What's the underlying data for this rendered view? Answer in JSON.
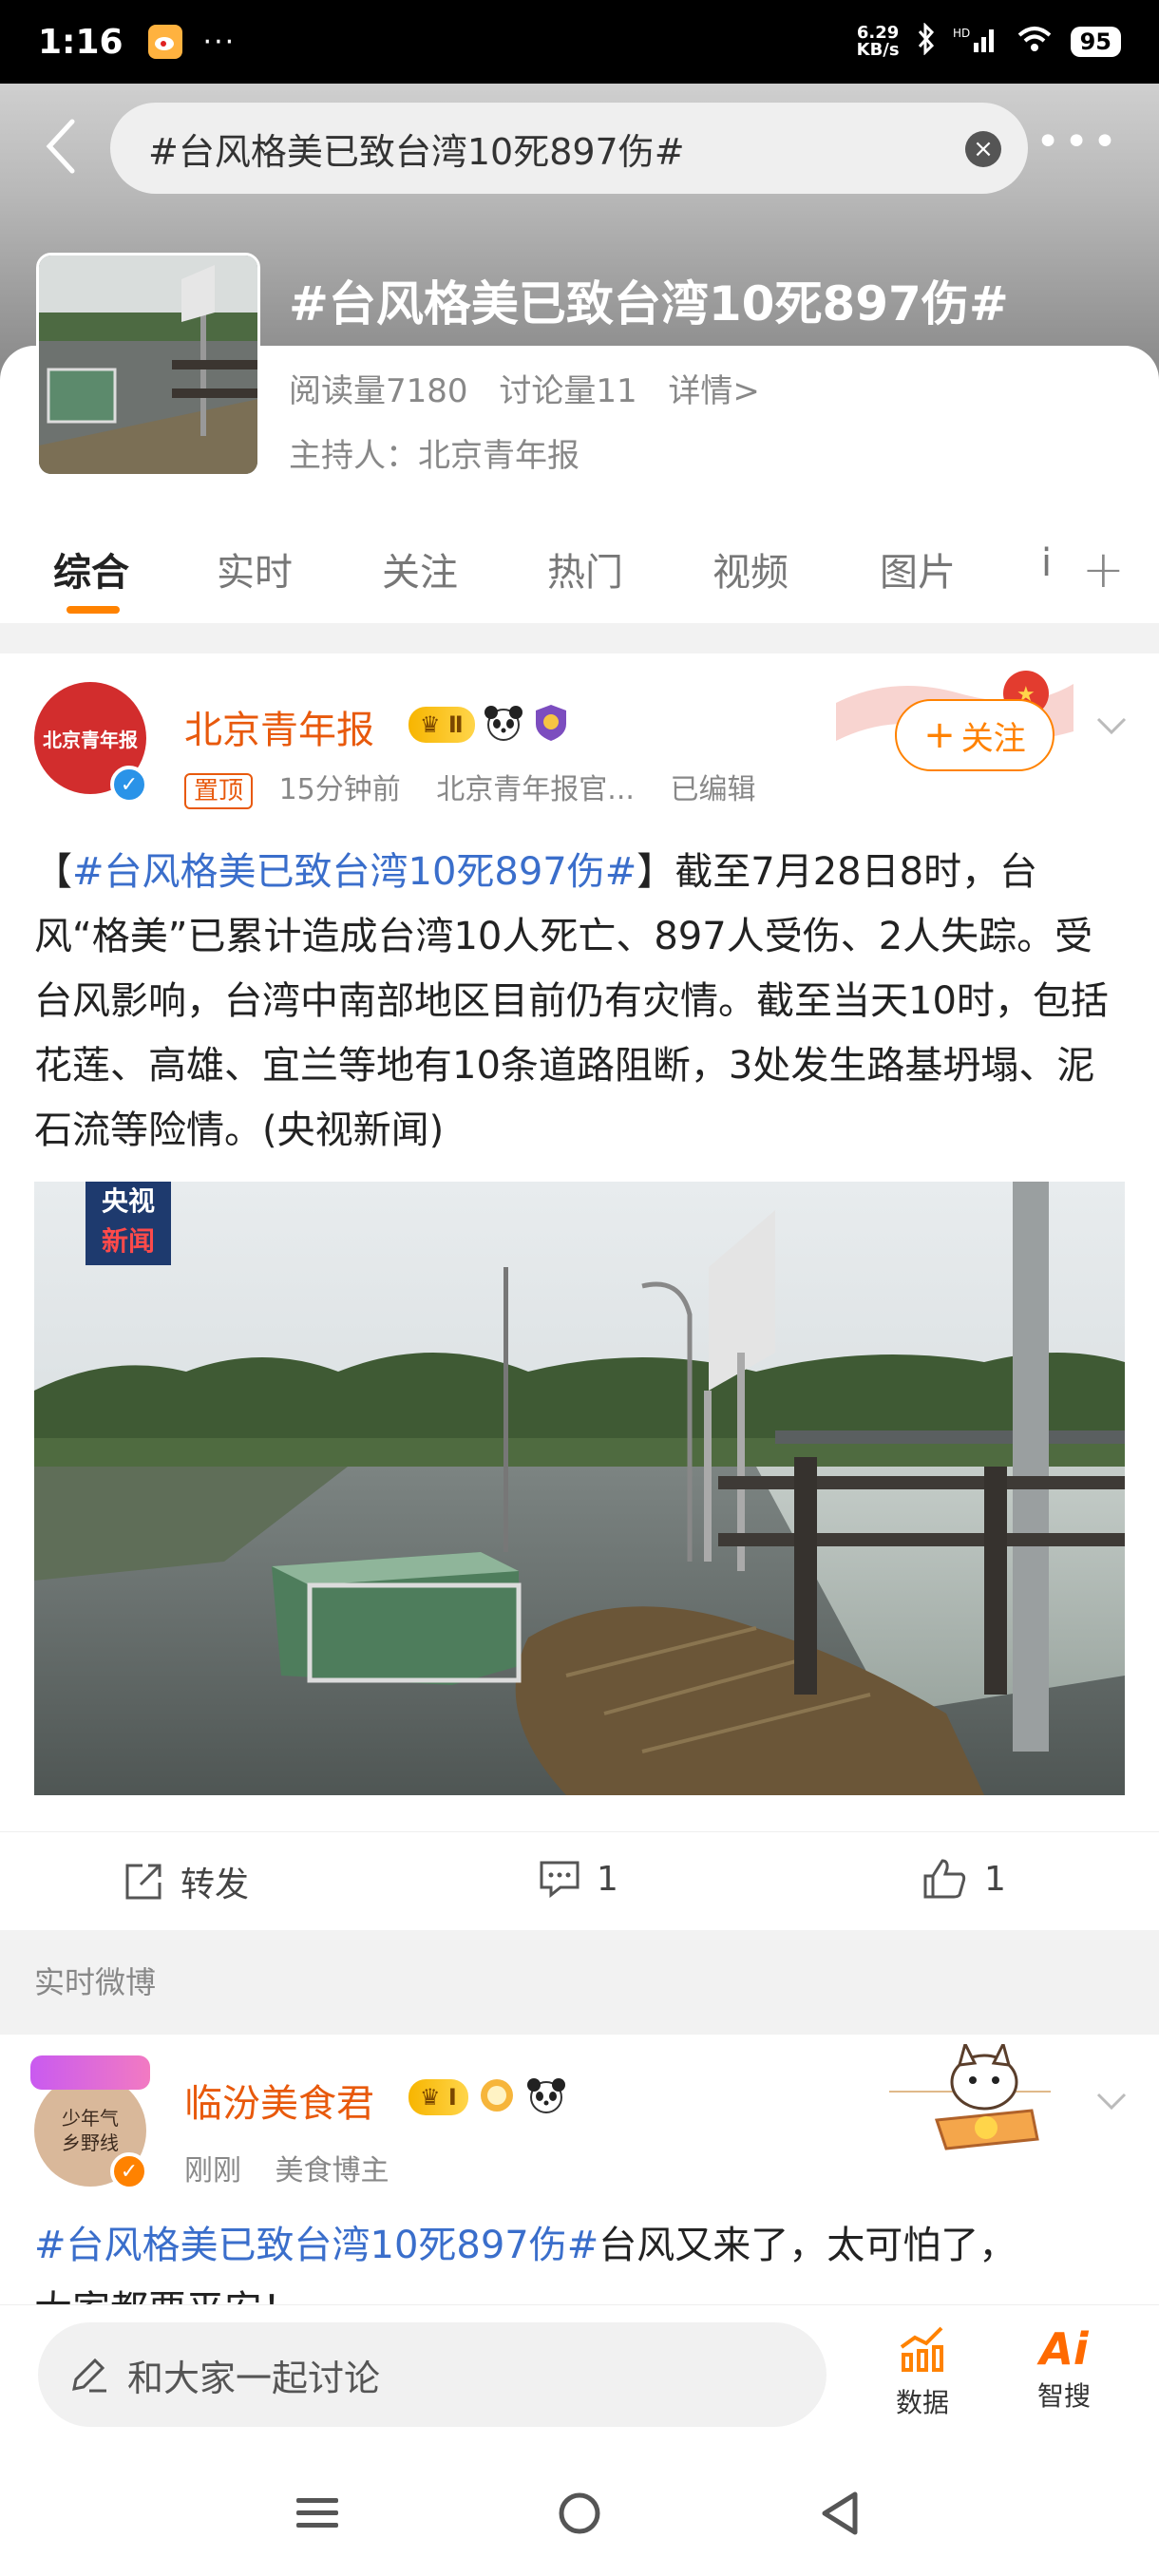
{
  "status_bar": {
    "time": "1:16",
    "dots": "···",
    "net_speed_value": "6.29",
    "net_speed_unit": "KB/s",
    "battery": "95"
  },
  "search": {
    "query": "#台风格美已致台湾10死897伤#",
    "clear_glyph": "×",
    "more_glyph": "•••"
  },
  "topic": {
    "title": "#台风格美已致台湾10死897伤#",
    "reads": "阅读量7180",
    "discussions": "讨论量11",
    "details": "详情>",
    "host": "主持人：北京青年报"
  },
  "tabs": [
    "综合",
    "实时",
    "关注",
    "热门",
    "视频",
    "图片",
    "i"
  ],
  "tab_plus": "+",
  "post1": {
    "user": "北京青年报",
    "vip_level": "Ⅱ",
    "pinned": "置顶",
    "time": "15分钟前",
    "source": "北京青年报官...",
    "edited": "已编辑",
    "follow": "关注",
    "follow_plus": "+",
    "text_open": "【",
    "text_tag": "#台风格美已致台湾10死897伤#",
    "text_body": "】截至7月28日8时，台风“格美”已累计造成台湾10人死亡、897人受伤、2人失踪。受台风影响，台湾中南部地区目前仍有灾情。截至当天10时，包括花莲、高雄、宜兰等地有10条道路阻断，3处发生路基坍塌、泥石流等险情。(央视新闻)",
    "watermark_line1": "央视",
    "watermark_line2": "新闻",
    "avatar_text": "北京青年报",
    "repost_label": "转发",
    "comments": "1",
    "likes": "1"
  },
  "section_label": "实时微博",
  "post2": {
    "user": "临汾美食君",
    "vip_level": "Ⅰ",
    "time": "刚刚",
    "role": "美食博主",
    "avatar_text": "少年气 乡野线",
    "text_tag": "#台风格美已致台湾10死897伤#",
    "text_body": "台风又来了，太可怕了，",
    "text_line2": "大家都要平安！"
  },
  "bottom": {
    "discuss_placeholder": "和大家一起讨论",
    "data_label": "数据",
    "ai_label": "智搜",
    "ai_glyph": "Ai"
  },
  "colors": {
    "accent": "#ff8200",
    "username": "#e8590c",
    "hashtag": "#3a6ecb"
  }
}
